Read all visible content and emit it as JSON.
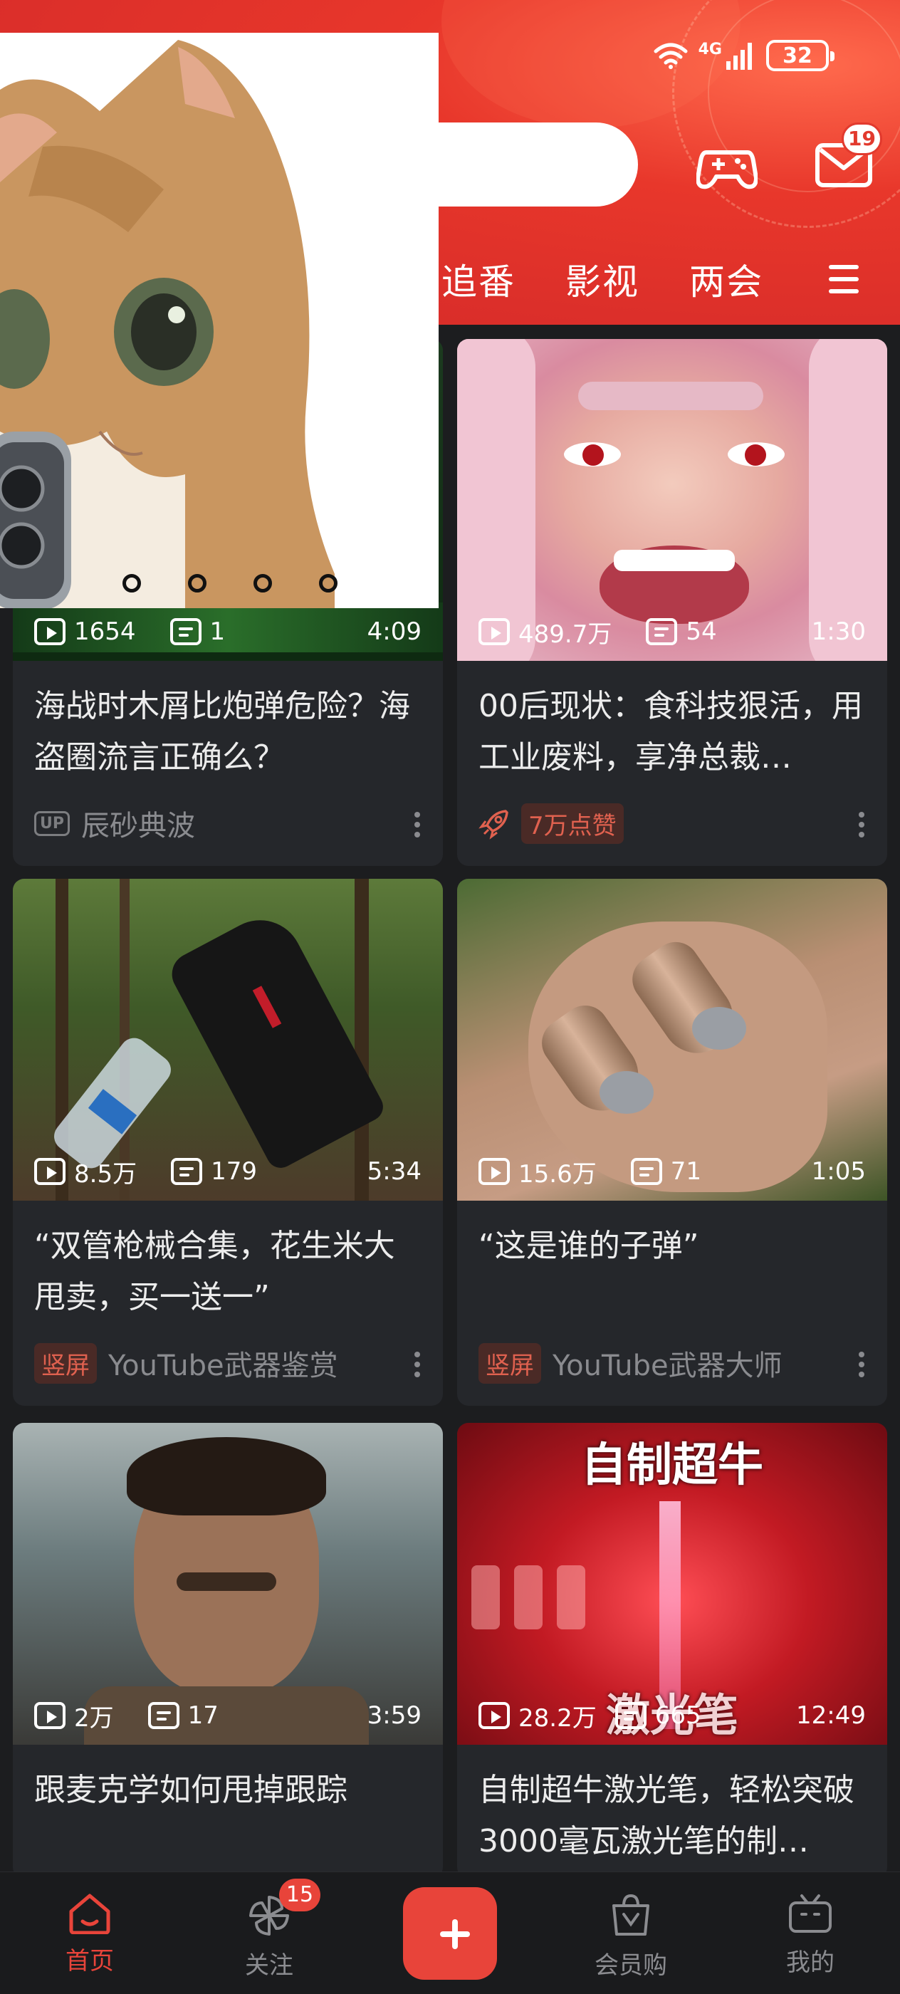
{
  "status_bar": {
    "network": "4G",
    "battery": "32"
  },
  "header": {
    "mail_badge": "19",
    "tabs": [
      "追番",
      "影视",
      "两会"
    ]
  },
  "feed": [
    {
      "views": "1654",
      "danmaku": "1",
      "duration": "4:09",
      "title": "海战时木屑比炮弹危险？海盗圈流言正确么？",
      "tag": "UP",
      "author": "辰砂典波"
    },
    {
      "views": "489.7万",
      "danmaku": "54",
      "duration": "1:30",
      "title": "00后现状：食科技狠活，用工业废料，享净总裁…",
      "badge": "7万点赞"
    },
    {
      "views": "8.5万",
      "danmaku": "179",
      "duration": "5:34",
      "title": "“双管枪械合集，花生米大甩卖，买一送一”",
      "tag": "竖屏",
      "author": "YouTube武器鉴赏"
    },
    {
      "views": "15.6万",
      "danmaku": "71",
      "duration": "1:05",
      "title": "“这是谁的子弹”",
      "tag": "竖屏",
      "author": "YouTube武器大师"
    },
    {
      "views": "2万",
      "danmaku": "17",
      "duration": "3:59",
      "title": "跟麦克学如何甩掉跟踪"
    },
    {
      "views": "28.2万",
      "danmaku": "665",
      "duration": "12:49",
      "title": "自制超牛激光笔，轻松突破3000毫瓦激光笔的制…",
      "overlay_top": "自制超牛",
      "overlay_bottom": "激光笔"
    }
  ],
  "bottom_nav": {
    "home": "首页",
    "follow": "关注",
    "follow_badge": "15",
    "shop": "会员购",
    "mine": "我的"
  },
  "colors": {
    "brand_red": "#e8443a",
    "header_red": "#dc2f2a",
    "background": "#1c1d1f"
  }
}
